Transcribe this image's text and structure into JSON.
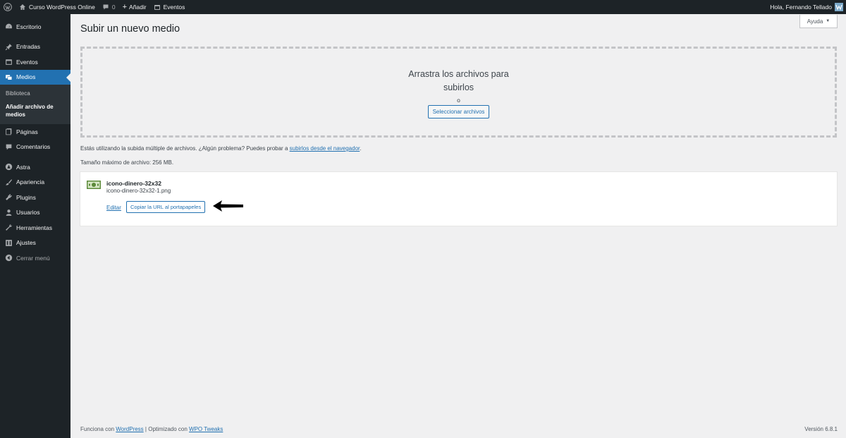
{
  "adminbar": {
    "site_name": "Curso WordPress Online",
    "comments_count": "0",
    "add_label": "Añadir",
    "events_label": "Eventos",
    "greeting": "Hola, Fernando Tellado"
  },
  "sidebar": {
    "items": [
      {
        "label": "Escritorio",
        "icon": "dashboard-icon"
      },
      {
        "label": "Entradas",
        "icon": "pin-icon"
      },
      {
        "label": "Eventos",
        "icon": "calendar-icon"
      },
      {
        "label": "Medios",
        "icon": "media-icon",
        "current": true
      },
      {
        "label": "Páginas",
        "icon": "pages-icon"
      },
      {
        "label": "Comentarios",
        "icon": "comment-icon"
      },
      {
        "label": "Astra",
        "icon": "astra-icon"
      },
      {
        "label": "Apariencia",
        "icon": "brush-icon"
      },
      {
        "label": "Plugins",
        "icon": "plugin-icon"
      },
      {
        "label": "Usuarios",
        "icon": "user-icon"
      },
      {
        "label": "Herramientas",
        "icon": "wrench-icon"
      },
      {
        "label": "Ajustes",
        "icon": "settings-icon"
      },
      {
        "label": "Cerrar menú",
        "icon": "collapse-icon"
      }
    ],
    "submenu": [
      "Biblioteca",
      "Añadir archivo de medios"
    ]
  },
  "main": {
    "help_label": "Ayuda",
    "title": "Subir un nuevo medio",
    "drop_text": "Arrastra los archivos para subirlos",
    "or_text": "o",
    "select_button": "Seleccionar archivos",
    "info_text": "Estás utilizando la subida múltiple de archivos. ¿Algún problema? Puedes probar a",
    "info_link": "subirlos desde el navegador",
    "info_end": ".",
    "max_size": "Tamaño máximo de archivo: 256 MB."
  },
  "media_item": {
    "title": "icono-dinero-32x32",
    "filename": "icono-dinero-32x32-1.png",
    "edit_label": "Editar",
    "copy_button": "Copiar la URL al portapapeles"
  },
  "footer": {
    "text1": "Funciona con",
    "link1": "WordPress",
    "text2": "| Optimizado con",
    "link2": "WPO Tweaks",
    "version": "Versión 6.8.1"
  },
  "colors": {
    "accent": "#2271b1",
    "adminbar_bg": "#1d2327",
    "page_bg": "#f0f0f1"
  }
}
